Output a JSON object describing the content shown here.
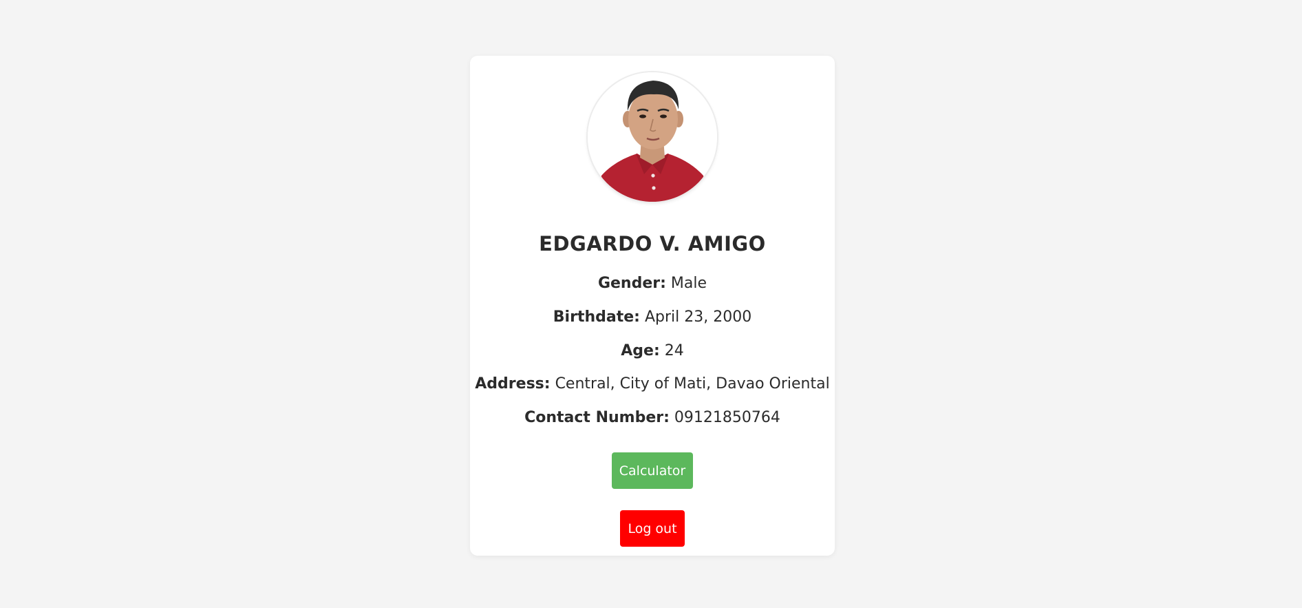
{
  "profile": {
    "name": "EDGARDO V. AMIGO",
    "gender_label": "Gender:",
    "gender": "Male",
    "birthdate_label": "Birthdate:",
    "birthdate": "April 23, 2000",
    "age_label": "Age:",
    "age": "24",
    "address_label": "Address:",
    "address": "Central, City of Mati, Davao Oriental",
    "contact_label": "Contact Number:",
    "contact": "09121850764"
  },
  "buttons": {
    "calculator": "Calculator",
    "logout": "Log out"
  },
  "colors": {
    "calculator": "#5cb85c",
    "logout": "#ff0000",
    "background": "#f4f4f4",
    "card": "#ffffff"
  }
}
